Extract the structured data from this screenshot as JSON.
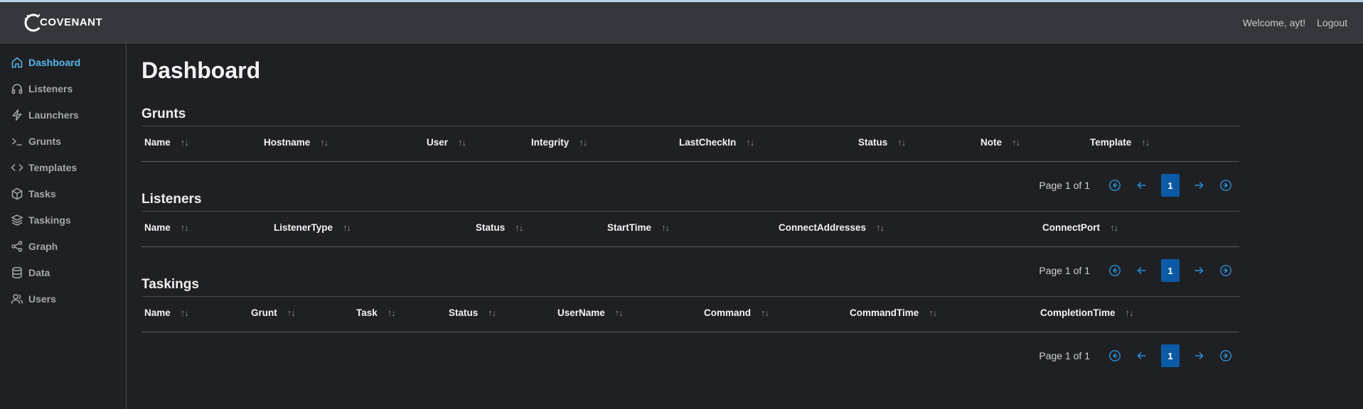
{
  "app": {
    "brand": "COVENANT"
  },
  "header": {
    "welcome": "Welcome, ayt!",
    "logout": "Logout"
  },
  "sidebar": {
    "items": [
      {
        "label": "Dashboard",
        "icon": "home-icon",
        "active": true
      },
      {
        "label": "Listeners",
        "icon": "headphones-icon"
      },
      {
        "label": "Launchers",
        "icon": "lightning-icon"
      },
      {
        "label": "Grunts",
        "icon": "terminal-icon"
      },
      {
        "label": "Templates",
        "icon": "code-icon"
      },
      {
        "label": "Tasks",
        "icon": "box-icon"
      },
      {
        "label": "Taskings",
        "icon": "layers-icon"
      },
      {
        "label": "Graph",
        "icon": "share-icon"
      },
      {
        "label": "Data",
        "icon": "database-icon"
      },
      {
        "label": "Users",
        "icon": "users-icon"
      }
    ]
  },
  "page": {
    "title": "Dashboard"
  },
  "sections": {
    "grunts": {
      "title": "Grunts",
      "columns": [
        "Name",
        "Hostname",
        "User",
        "Integrity",
        "LastCheckIn",
        "Status",
        "Note",
        "Template"
      ],
      "pager": {
        "info": "Page 1 of 1",
        "page": "1"
      }
    },
    "listeners": {
      "title": "Listeners",
      "columns": [
        "Name",
        "ListenerType",
        "Status",
        "StartTime",
        "ConnectAddresses",
        "ConnectPort"
      ],
      "pager": {
        "info": "Page 1 of 1",
        "page": "1"
      }
    },
    "taskings": {
      "title": "Taskings",
      "columns": [
        "Name",
        "Grunt",
        "Task",
        "Status",
        "UserName",
        "Command",
        "CommandTime",
        "CompletionTime"
      ],
      "pager": {
        "info": "Page 1 of 1",
        "page": "1"
      }
    }
  },
  "sort_icon": "↑↓",
  "colors": {
    "accent": "#58b8ec",
    "pager_active": "#0b5aa6",
    "background": "#1f2023",
    "topbar": "#34373c"
  }
}
